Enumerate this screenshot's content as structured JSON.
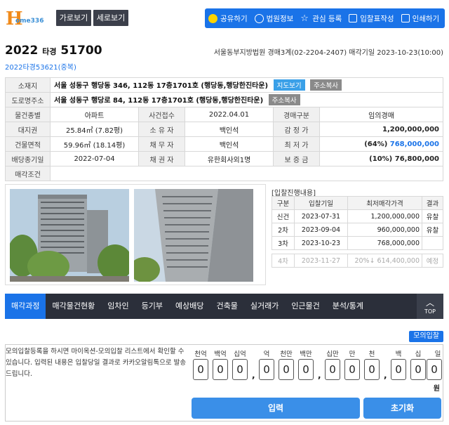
{
  "logo": {
    "mark": "H",
    "text": "ome336"
  },
  "view_buttons": {
    "horizontal": "가로보기",
    "vertical": "세로보기"
  },
  "top_actions": [
    {
      "label": "공유하기",
      "icon": "kakao-icon"
    },
    {
      "label": "법원정보",
      "icon": "court-icon"
    },
    {
      "label": "관심 등록",
      "icon": "star-icon"
    },
    {
      "label": "입찰표작성",
      "icon": "form-icon"
    },
    {
      "label": "인쇄하기",
      "icon": "print-icon"
    }
  ],
  "case": {
    "year": "2022",
    "type": "타경",
    "number": "51700",
    "related": "2022타경53621(중복)"
  },
  "court_info": "서울동부지방법원 경매3계(02-2204-2407) 매각기일 2023-10-23(10:00)",
  "info": {
    "location_label": "소재지",
    "location": "서울 성동구 행당동 346, 112동 17층1701호 (행당동,행당한진타운)",
    "map_btn": "지도보기",
    "copy_btn": "주소복사",
    "road_label": "도로명주소",
    "road": "서울 성동구 행당로 84, 112동 17층1701호 (행당동,행당한진타운)",
    "type_label": "물건종별",
    "type": "아파트",
    "received_label": "사건접수",
    "received": "2022.04.01",
    "auction_type_label": "경매구분",
    "auction_type": "임의경매",
    "land_label": "대지권",
    "land": "25.84㎡ (7.82평)",
    "owner_label": "소 유 자",
    "owner": "백인석",
    "appraisal_label": "감 정 가",
    "appraisal": "1,200,000,000",
    "building_label": "건물면적",
    "building": "59.96㎡ (18.14평)",
    "debtor_label": "채 무 자",
    "debtor": "백인석",
    "min_label": "최 저 가",
    "min_pct": "(64%)",
    "min_price": "768,000,000",
    "deadline_label": "배당종기일",
    "deadline": "2022-07-04",
    "creditor_label": "채 권 자",
    "creditor": "유한회사외1명",
    "deposit_label": "보 증 금",
    "deposit": "(10%) 76,800,000",
    "condition_label": "매각조건",
    "condition": ""
  },
  "bid_progress": {
    "title": "[입찰진행내용]",
    "headers": [
      "구분",
      "입찰기일",
      "최저매각가격",
      "결과"
    ],
    "rows": [
      {
        "round": "신건",
        "date": "2023-07-31",
        "price": "1,200,000,000",
        "result": "유찰"
      },
      {
        "round": "2차",
        "date": "2023-09-04",
        "price": "960,000,000",
        "result": "유찰"
      },
      {
        "round": "3차",
        "date": "2023-10-23",
        "price": "768,000,000",
        "result": ""
      },
      {
        "round": "4차",
        "date": "2023-11-27",
        "price": "20%↓ 614,400,000",
        "result": "예정"
      }
    ]
  },
  "tabs": [
    "매각과정",
    "매각물건현황",
    "임차인",
    "등기부",
    "예상배당",
    "건축물",
    "실거래가",
    "인근물건",
    "분석/통계"
  ],
  "top_label": "TOP",
  "mock": {
    "badge": "모의입찰",
    "text": "모의입찰등록을 하시면 마이옥션-모의입찰 리스트에서 확인할 수 있습니다. 입력된 내용은 입찰당일 결과로 카카오알림톡으로 발송 드립니다.",
    "units": [
      "천억",
      "백억",
      "십억",
      "억",
      "천만",
      "백만",
      "십만",
      "만",
      "천",
      "백",
      "십",
      "일"
    ],
    "digits": [
      "0",
      "0",
      "0",
      "0",
      "0",
      "0",
      "0",
      "0",
      "0",
      "0",
      "0",
      "0"
    ],
    "won": "원",
    "input_btn": "입력",
    "reset_btn": "초기화"
  }
}
